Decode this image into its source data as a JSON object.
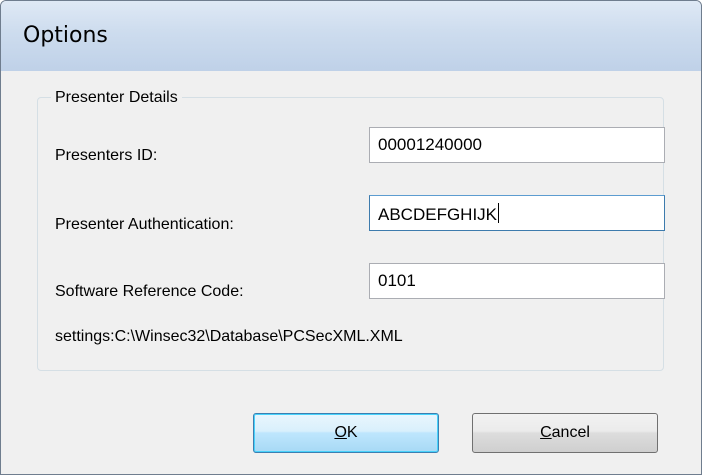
{
  "window": {
    "title": "Options"
  },
  "group": {
    "legend": "Presenter Details"
  },
  "fields": {
    "presenter_id": {
      "label": "Presenters ID:",
      "value": "00001240000"
    },
    "presenter_auth": {
      "label": "Presenter Authentication:",
      "value": "ABCDEFGHIJK"
    },
    "software_ref": {
      "label": "Software Reference Code:",
      "value": "0101"
    }
  },
  "settings_path": "settings:C:\\Winsec32\\Database\\PCSecXML.XML",
  "buttons": {
    "ok": {
      "mnemonic": "O",
      "rest": "K"
    },
    "cancel": {
      "mnemonic": "C",
      "rest": "ancel"
    }
  }
}
